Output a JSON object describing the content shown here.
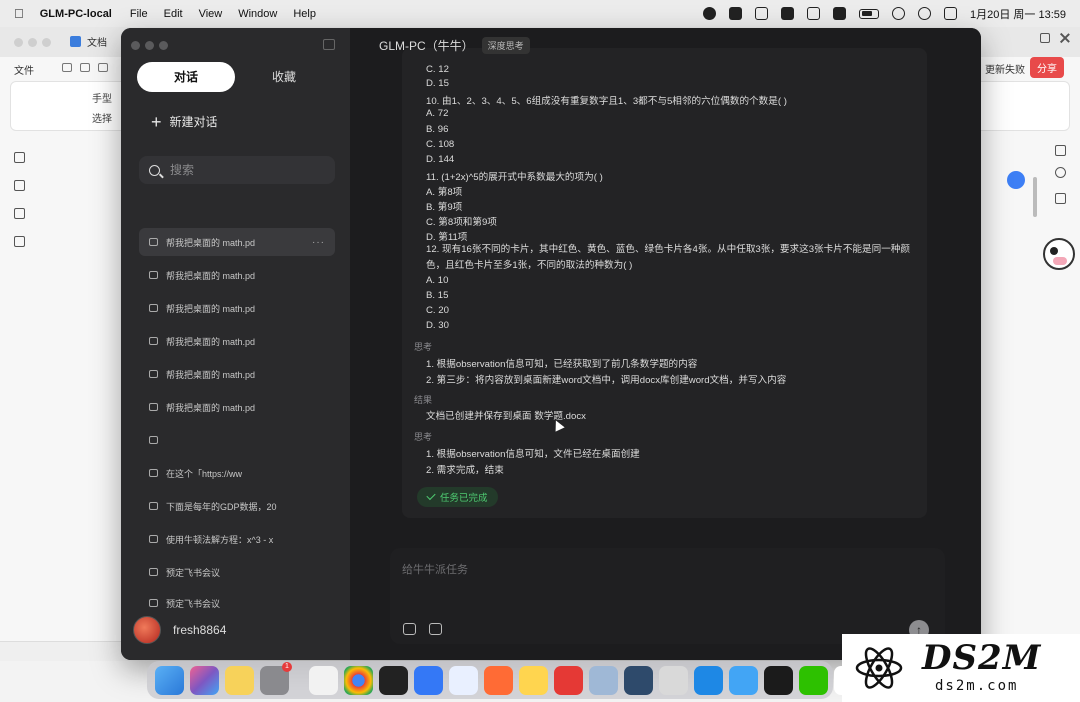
{
  "menubar": {
    "app_name": "GLM-PC-local",
    "menus": [
      "File",
      "Edit",
      "View",
      "Window",
      "Help"
    ],
    "clock": "1月20日 周一 13:59"
  },
  "background_app": {
    "tab_label": "文档",
    "file_menu": "文件",
    "ribbon_hand": "手型",
    "ribbon_select": "选择",
    "update_label": "更新失败",
    "share_label": "分享"
  },
  "sidebar": {
    "tabs": [
      {
        "label": "对话",
        "active": true
      },
      {
        "label": "收藏",
        "active": false
      }
    ],
    "new_chat_label": "新建对话",
    "search_placeholder": "搜索",
    "history": [
      {
        "label": "帮我把桌面的 math.pd",
        "active": true
      },
      {
        "label": "帮我把桌面的 math.pd"
      },
      {
        "label": "帮我把桌面的 math.pd"
      },
      {
        "label": "帮我把桌面的 math.pd"
      },
      {
        "label": "帮我把桌面的 math.pd"
      },
      {
        "label": "帮我把桌面的 math.pd"
      },
      {
        "label": ""
      },
      {
        "label": "在这个「https://ww"
      },
      {
        "label": "下面是每年的GDP数据，20"
      },
      {
        "label": "使用牛顿法解方程：x^3 - x"
      },
      {
        "label": "预定飞书会议"
      },
      {
        "label": "预定飞书会议"
      }
    ],
    "more_label": "···",
    "username": "fresh8864"
  },
  "main": {
    "title": "GLM-PC（牛牛）",
    "mode_tag": "深度思考",
    "lines": [
      "C. 12",
      "D. 15",
      "10. 由1、2、3、4、5、6组成没有重复数字且1、3都不与5相邻的六位偶数的个数是( )",
      "A. 72",
      "B. 96",
      "C. 108",
      "D. 144",
      "11. (1+2x)^5的展开式中系数最大的项为( )",
      "A. 第8项",
      "B. 第9项",
      "C. 第8项和第9项",
      "D. 第11项",
      "12. 现有16张不同的卡片，其中红色、黄色、蓝色、绿色卡片各4张。从中任取3张，要求这3张卡片不能是同一种颜色，且红色卡片至多1张，不同的取法的种数为( )",
      "A. 10",
      "B. 15",
      "C. 20",
      "D. 30"
    ],
    "think_label_1": "思考",
    "think_1": [
      "1. 根据observation信息可知，已经获取到了前几条数学题的内容",
      "2. 第三步：将内容放到桌面新建word文档中，调用docx库创建word文档，并写入内容"
    ],
    "result_label": "结果",
    "result_text": "文档已创建并保存到桌面 数学题.docx",
    "think_label_2": "思考",
    "think_2": [
      "1. 根据observation信息可知，文件已经在桌面创建",
      "2. 需求完成，结束"
    ],
    "done_label": "任务已完成",
    "composer_placeholder": "给牛牛派任务"
  },
  "watermark": {
    "big": "DS2M",
    "small": "ds2m.com"
  },
  "dock_apps": [
    "finder-icon",
    "launchpad-icon",
    "notes-icon",
    "settings-icon",
    "textedit-icon",
    "chrome-icon",
    "terminal-icon",
    "feishu-icon",
    "mail-icon",
    "pen-icon",
    "photo-icon",
    "wps-icon",
    "preview-icon",
    "screen-icon",
    "rocket-icon",
    "appstore-icon",
    "safari-icon",
    "glm-icon",
    "wechat-icon",
    "cow-icon",
    "doc-icon"
  ],
  "colors": {
    "window_bg": "#1c1c1e",
    "sidebar_bg": "#2a2a2c",
    "success": "#4ecb71",
    "share": "#e84a4a"
  }
}
